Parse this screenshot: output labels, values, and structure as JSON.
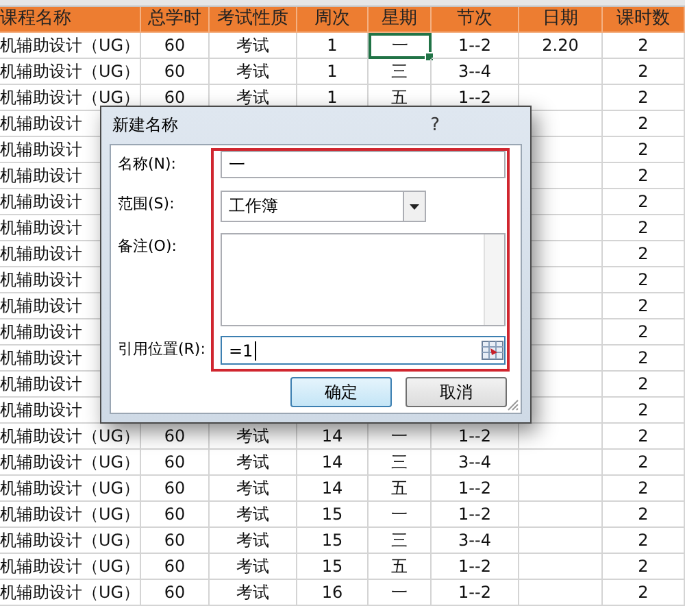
{
  "sheet": {
    "columns": [
      "课程名称",
      "总学时",
      "考试性质",
      "周次",
      "星期",
      "节次",
      "日期",
      "课时数"
    ],
    "rows": [
      {
        "kind": "full",
        "cells": [
          {
            "text": "机辅助设计（UG）",
            "selected": false
          },
          {
            "text": "60",
            "selected": false
          },
          {
            "text": "考试",
            "selected": false
          },
          {
            "text": "1",
            "selected": false
          },
          {
            "text": "一",
            "selected": true
          },
          {
            "text": "1--2",
            "selected": false
          },
          {
            "text": "2.20",
            "selected": false
          },
          {
            "text": "2",
            "selected": false
          }
        ]
      },
      {
        "kind": "full",
        "cells": [
          {
            "text": "机辅助设计（UG）",
            "selected": false
          },
          {
            "text": "60",
            "selected": false
          },
          {
            "text": "考试",
            "selected": false
          },
          {
            "text": "1",
            "selected": false
          },
          {
            "text": "三",
            "selected": false
          },
          {
            "text": "3--4",
            "selected": false
          },
          {
            "text": "",
            "selected": false
          },
          {
            "text": "2",
            "selected": false
          }
        ]
      },
      {
        "kind": "full",
        "cells": [
          {
            "text": "机辅助设计（UG）",
            "selected": false
          },
          {
            "text": "60",
            "selected": false
          },
          {
            "text": "考试",
            "selected": false
          },
          {
            "text": "1",
            "selected": false
          },
          {
            "text": "五",
            "selected": false
          },
          {
            "text": "1--2",
            "selected": false
          },
          {
            "text": "",
            "selected": false
          },
          {
            "text": "2",
            "selected": false
          }
        ]
      },
      {
        "kind": "covered",
        "cells": [
          {
            "text": "机辅助设计",
            "selected": false
          },
          {
            "text": "2",
            "selected": false
          }
        ]
      },
      {
        "kind": "covered",
        "cells": [
          {
            "text": "机辅助设计",
            "selected": false
          },
          {
            "text": "2",
            "selected": false
          }
        ]
      },
      {
        "kind": "covered",
        "cells": [
          {
            "text": "机辅助设计",
            "selected": false
          },
          {
            "text": "2",
            "selected": false
          }
        ]
      },
      {
        "kind": "covered",
        "cells": [
          {
            "text": "机辅助设计",
            "selected": false
          },
          {
            "text": "2",
            "selected": false
          }
        ]
      },
      {
        "kind": "covered",
        "cells": [
          {
            "text": "机辅助设计",
            "selected": false
          },
          {
            "text": "2",
            "selected": false
          }
        ]
      },
      {
        "kind": "covered",
        "cells": [
          {
            "text": "机辅助设计",
            "selected": false
          },
          {
            "text": "2",
            "selected": false
          }
        ]
      },
      {
        "kind": "covered",
        "cells": [
          {
            "text": "机辅助设计",
            "selected": false
          },
          {
            "text": "2",
            "selected": false
          }
        ]
      },
      {
        "kind": "covered",
        "cells": [
          {
            "text": "机辅助设计",
            "selected": false
          },
          {
            "text": "2",
            "selected": false
          }
        ]
      },
      {
        "kind": "covered",
        "cells": [
          {
            "text": "机辅助设计",
            "selected": false
          },
          {
            "text": "2",
            "selected": false
          }
        ]
      },
      {
        "kind": "covered",
        "cells": [
          {
            "text": "机辅助设计",
            "selected": false
          },
          {
            "text": "2",
            "selected": false
          }
        ]
      },
      {
        "kind": "covered",
        "cells": [
          {
            "text": "机辅助设计",
            "selected": false
          },
          {
            "text": "2",
            "selected": false
          }
        ]
      },
      {
        "kind": "covered",
        "cells": [
          {
            "text": "机辅助设计",
            "selected": false
          },
          {
            "text": "2",
            "selected": false
          }
        ]
      },
      {
        "kind": "full",
        "cells": [
          {
            "text": "机辅助设计（UG）",
            "selected": false
          },
          {
            "text": "60",
            "selected": false
          },
          {
            "text": "考试",
            "selected": false
          },
          {
            "text": "14",
            "selected": false
          },
          {
            "text": "一",
            "selected": false
          },
          {
            "text": "1--2",
            "selected": false
          },
          {
            "text": "",
            "selected": false
          },
          {
            "text": "2",
            "selected": false
          }
        ]
      },
      {
        "kind": "full",
        "cells": [
          {
            "text": "机辅助设计（UG）",
            "selected": false
          },
          {
            "text": "60",
            "selected": false
          },
          {
            "text": "考试",
            "selected": false
          },
          {
            "text": "14",
            "selected": false
          },
          {
            "text": "三",
            "selected": false
          },
          {
            "text": "3--4",
            "selected": false
          },
          {
            "text": "",
            "selected": false
          },
          {
            "text": "2",
            "selected": false
          }
        ]
      },
      {
        "kind": "full",
        "cells": [
          {
            "text": "机辅助设计（UG）",
            "selected": false
          },
          {
            "text": "60",
            "selected": false
          },
          {
            "text": "考试",
            "selected": false
          },
          {
            "text": "14",
            "selected": false
          },
          {
            "text": "五",
            "selected": false
          },
          {
            "text": "1--2",
            "selected": false
          },
          {
            "text": "",
            "selected": false
          },
          {
            "text": "2",
            "selected": false
          }
        ]
      },
      {
        "kind": "full",
        "cells": [
          {
            "text": "机辅助设计（UG）",
            "selected": false
          },
          {
            "text": "60",
            "selected": false
          },
          {
            "text": "考试",
            "selected": false
          },
          {
            "text": "15",
            "selected": false
          },
          {
            "text": "一",
            "selected": false
          },
          {
            "text": "1--2",
            "selected": false
          },
          {
            "text": "",
            "selected": false
          },
          {
            "text": "2",
            "selected": false
          }
        ]
      },
      {
        "kind": "full",
        "cells": [
          {
            "text": "机辅助设计（UG）",
            "selected": false
          },
          {
            "text": "60",
            "selected": false
          },
          {
            "text": "考试",
            "selected": false
          },
          {
            "text": "15",
            "selected": false
          },
          {
            "text": "三",
            "selected": false
          },
          {
            "text": "3--4",
            "selected": false
          },
          {
            "text": "",
            "selected": false
          },
          {
            "text": "2",
            "selected": false
          }
        ]
      },
      {
        "kind": "full",
        "cells": [
          {
            "text": "机辅助设计（UG）",
            "selected": false
          },
          {
            "text": "60",
            "selected": false
          },
          {
            "text": "考试",
            "selected": false
          },
          {
            "text": "15",
            "selected": false
          },
          {
            "text": "五",
            "selected": false
          },
          {
            "text": "1--2",
            "selected": false
          },
          {
            "text": "",
            "selected": false
          },
          {
            "text": "2",
            "selected": false
          }
        ]
      },
      {
        "kind": "full",
        "cells": [
          {
            "text": "机辅助设计（UG）",
            "selected": false
          },
          {
            "text": "60",
            "selected": false
          },
          {
            "text": "考试",
            "selected": false
          },
          {
            "text": "16",
            "selected": false
          },
          {
            "text": "一",
            "selected": false
          },
          {
            "text": "1--2",
            "selected": false
          },
          {
            "text": "",
            "selected": false
          },
          {
            "text": "2",
            "selected": false
          }
        ]
      }
    ]
  },
  "dialog": {
    "title": "新建名称",
    "help": "?",
    "highlight_box": true,
    "fields": [
      {
        "kind": "text",
        "label": "名称(N):",
        "value": "一",
        "focused": false
      },
      {
        "kind": "select",
        "label": "范围(S):",
        "value": "工作簿",
        "focused": false
      },
      {
        "kind": "textarea",
        "label": "备注(O):",
        "focused": false
      },
      {
        "kind": "ref",
        "label": "引用位置(R):",
        "value": "=1",
        "focused": true
      }
    ],
    "buttons": [
      {
        "label": "确定",
        "default": true
      },
      {
        "label": "取消",
        "default": false
      }
    ]
  }
}
